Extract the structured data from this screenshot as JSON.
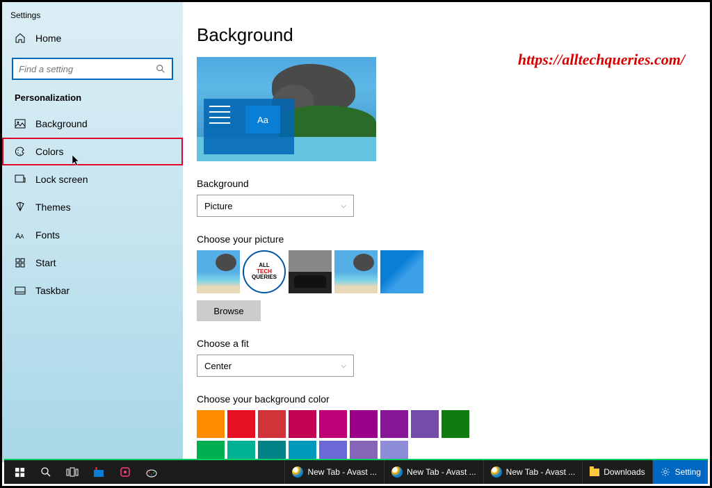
{
  "window_title": "Settings",
  "watermark": "https://alltechqueries.com/",
  "sidebar": {
    "home": "Home",
    "search_placeholder": "Find a setting",
    "section": "Personalization",
    "items": [
      {
        "label": "Background"
      },
      {
        "label": "Colors"
      },
      {
        "label": "Lock screen"
      },
      {
        "label": "Themes"
      },
      {
        "label": "Fonts"
      },
      {
        "label": "Start"
      },
      {
        "label": "Taskbar"
      }
    ]
  },
  "main": {
    "title": "Background",
    "preview_tile_text": "Aa",
    "bg_label": "Background",
    "bg_value": "Picture",
    "choose_picture_label": "Choose your picture",
    "thumb_logo": {
      "l1": "ALL",
      "l2": "TECH",
      "l3": "QUERIES"
    },
    "browse": "Browse",
    "fit_label": "Choose a fit",
    "fit_value": "Center",
    "color_label": "Choose your background color",
    "colors_row1": [
      "#ff8c00",
      "#e81123",
      "#d13438",
      "#c30052",
      "#bf0077",
      "#9a0089",
      "#881798",
      "#744da9"
    ],
    "colors_row2": [
      "#107c10",
      "#00b050",
      "#00b294",
      "#038387",
      "#0099bc",
      "#6b69d6",
      "#8764b8",
      "#8e8cd8"
    ]
  },
  "taskbar": {
    "tabs": [
      {
        "label": "New Tab - Avast ..."
      },
      {
        "label": "New Tab - Avast ..."
      },
      {
        "label": "New Tab - Avast ..."
      }
    ],
    "downloads": "Downloads",
    "settings": "Setting"
  }
}
